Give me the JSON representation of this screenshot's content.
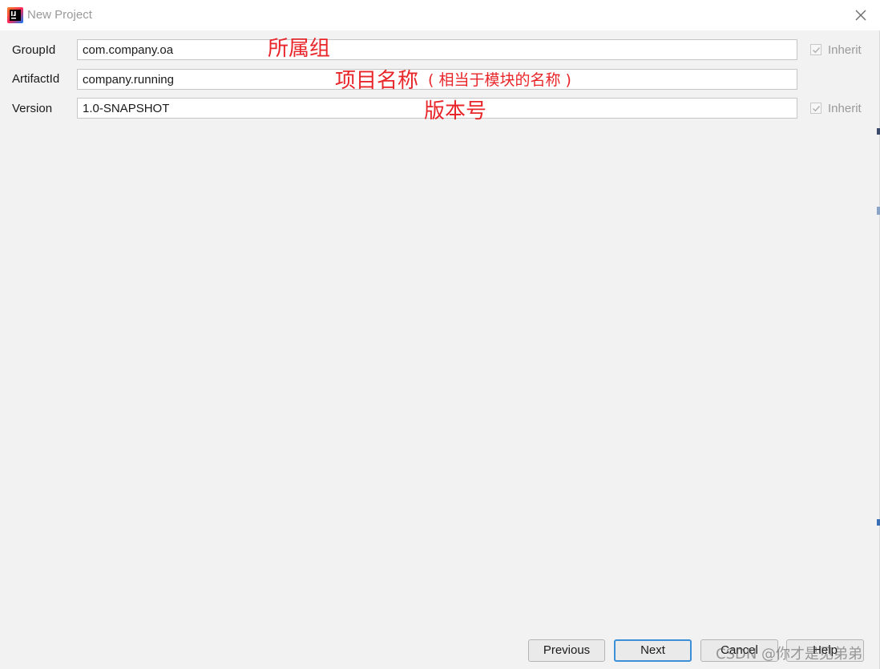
{
  "window": {
    "title": "New Project",
    "app_icon": "intellij-idea-icon",
    "close_icon": "close-icon"
  },
  "form": {
    "group_id": {
      "label": "GroupId",
      "value": "com.company.oa",
      "inherit_label": "Inherit",
      "inherit_checked": true
    },
    "artifact_id": {
      "label": "ArtifactId",
      "value": "company.running"
    },
    "version": {
      "label": "Version",
      "value": "1.0-SNAPSHOT",
      "inherit_label": "Inherit",
      "inherit_checked": true
    }
  },
  "annotations": {
    "group_note": "所属组",
    "artifact_note": "项目名称",
    "artifact_note_small": "( 相当于模块的名称 )",
    "version_note": "版本号",
    "color": "#e8262a"
  },
  "buttons": {
    "previous": "Previous",
    "next": "Next",
    "cancel": "Cancel",
    "help": "Help"
  },
  "watermark": "CSDN @你才是见弟弟"
}
